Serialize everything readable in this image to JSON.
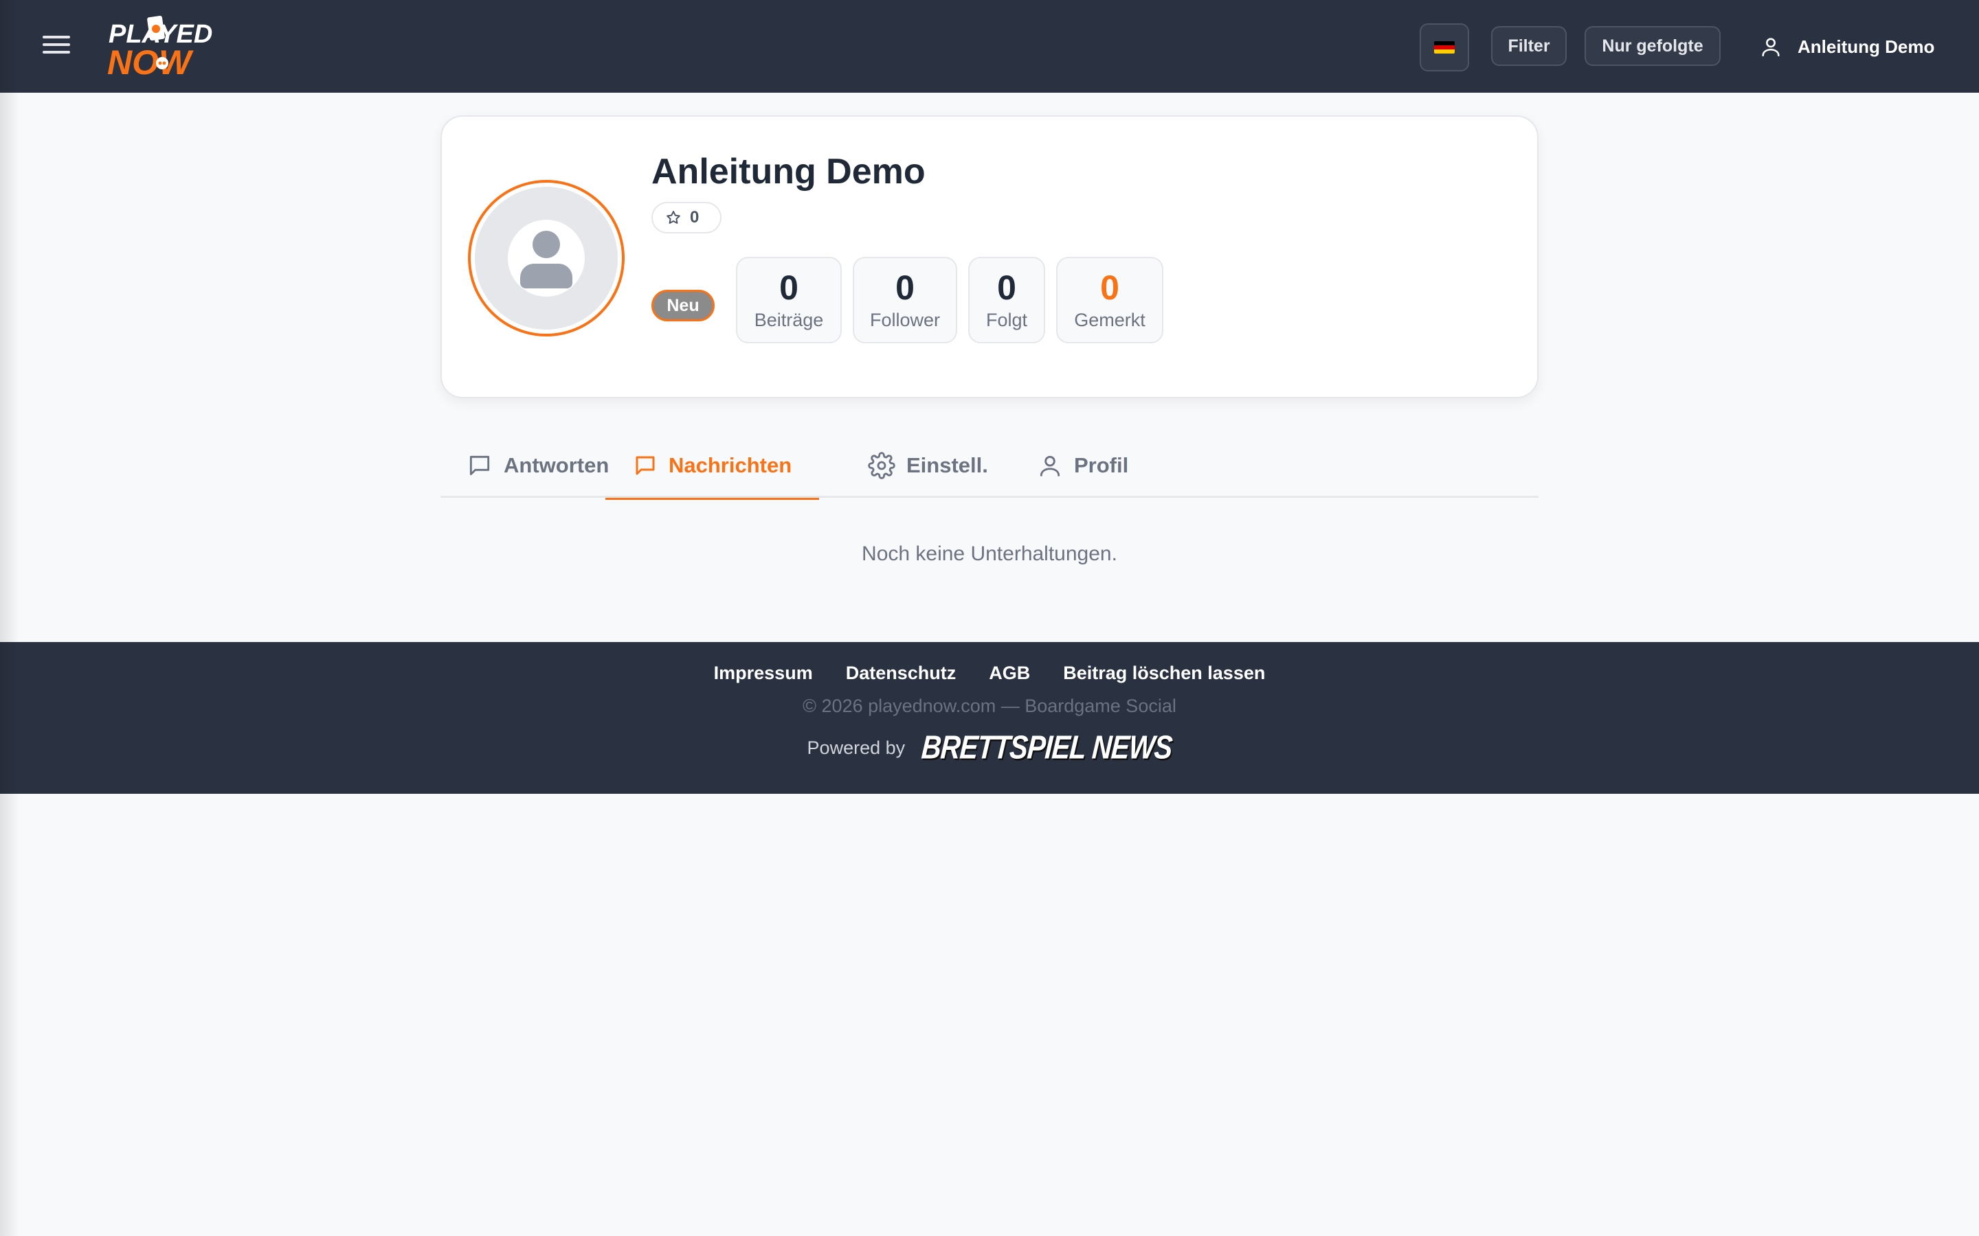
{
  "header": {
    "logo_top": "PLAYED",
    "logo_bottom": "NOW",
    "language_flag": "de-flag",
    "filter_label": "Filter",
    "following_only_label": "Nur gefolgte",
    "user_name": "Anleitung Demo"
  },
  "profile": {
    "name": "Anleitung Demo",
    "rating": "0",
    "level_badge": "Neu",
    "stats": [
      {
        "value": "0",
        "label": "Beiträge"
      },
      {
        "value": "0",
        "label": "Follower"
      },
      {
        "value": "0",
        "label": "Folgt"
      },
      {
        "value": "0",
        "label": "Gemerkt"
      }
    ]
  },
  "tabs": [
    {
      "label": "Antworten",
      "icon": "comment-icon",
      "active": false
    },
    {
      "label": "Nachrichten",
      "icon": "message-icon",
      "active": true
    },
    {
      "label": "Einstell.",
      "icon": "gear-icon",
      "active": false
    },
    {
      "label": "Profil",
      "icon": "user-icon",
      "active": false
    }
  ],
  "content": {
    "empty_message": "Noch keine Unterhaltungen."
  },
  "footer": {
    "links": [
      "Impressum",
      "Datenschutz",
      "AGB",
      "Beitrag löschen lassen"
    ],
    "copyright": "© 2026 playednow.com — Boardgame Social",
    "powered_by": "Powered by",
    "partner_logo": "BRETTSPIEL NEWS"
  },
  "colors": {
    "accent": "#f97316",
    "header_bg": "#2a3140",
    "page_bg": "#f8f9fb"
  }
}
